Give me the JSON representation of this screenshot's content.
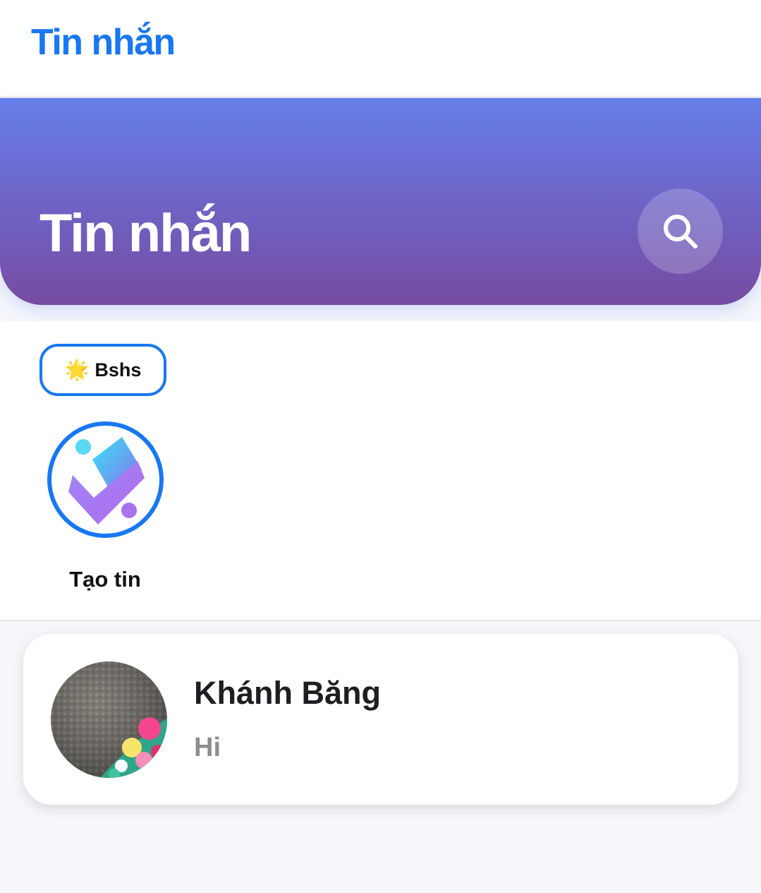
{
  "topbar": {
    "title": "Tin nhắn"
  },
  "hero": {
    "title": "Tin nhắn",
    "search_icon": "search-icon"
  },
  "stories": {
    "chip": {
      "emoji": "🌟",
      "label": "Bshs"
    },
    "create_caption": "Tạo tin"
  },
  "conversations": [
    {
      "name": "Khánh Băng",
      "preview": "Hi"
    }
  ],
  "colors": {
    "accent": "#1877f2",
    "hero_start": "#667eea",
    "hero_end": "#764ba2",
    "preview_text": "#8a8d91"
  }
}
